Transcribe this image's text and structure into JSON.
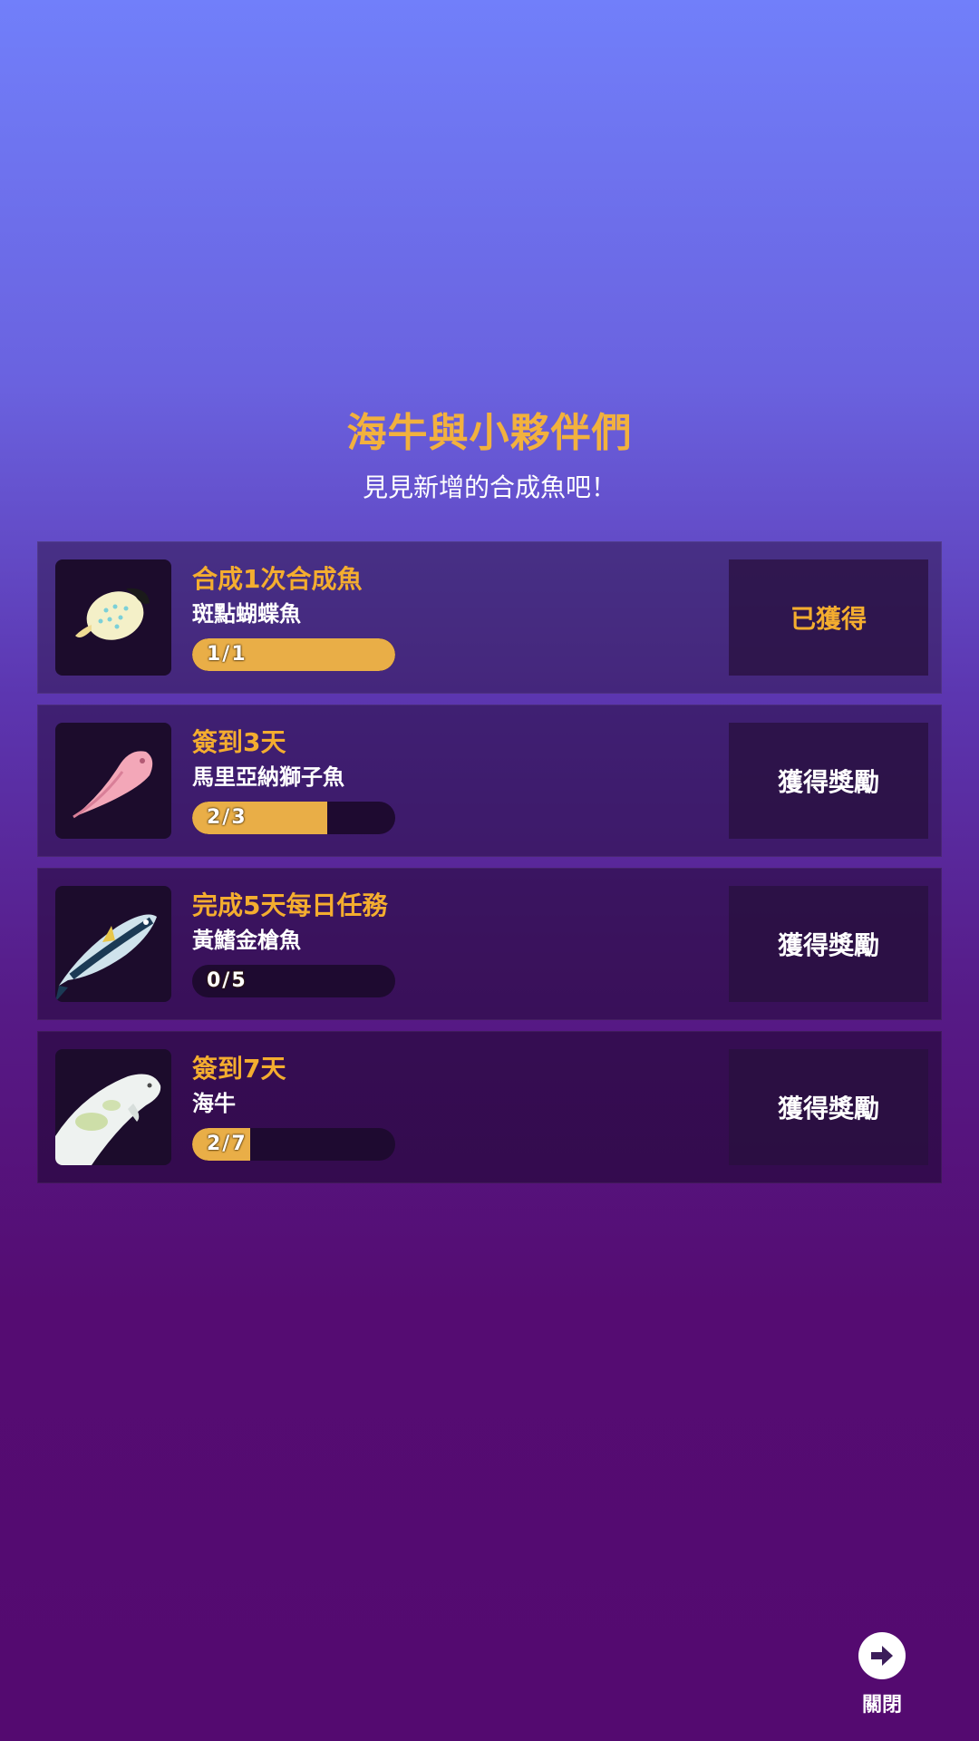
{
  "header": {
    "title": "海牛與小夥伴們",
    "subtitle": "見見新增的合成魚吧！"
  },
  "tasks": [
    {
      "task": "合成1次合成魚",
      "fish": "斑點蝴蝶魚",
      "progress_label": "1/1",
      "progress_fraction": 1.0,
      "action_label": "已獲得",
      "claimed": true,
      "icon": "spotted-butterflyfish-icon"
    },
    {
      "task": "簽到3天",
      "fish": "馬里亞納獅子魚",
      "progress_label": "2/3",
      "progress_fraction": 0.667,
      "action_label": "獲得獎勵",
      "claimed": false,
      "icon": "mariana-snailfish-icon"
    },
    {
      "task": "完成5天每日任務",
      "fish": "黃鰭金槍魚",
      "progress_label": "0/5",
      "progress_fraction": 0.0,
      "action_label": "獲得獎勵",
      "claimed": false,
      "icon": "yellowfin-tuna-icon"
    },
    {
      "task": "簽到7天",
      "fish": "海牛",
      "progress_label": "2/7",
      "progress_fraction": 0.286,
      "action_label": "獲得獎勵",
      "claimed": false,
      "icon": "manatee-icon"
    }
  ],
  "close": {
    "label": "關閉",
    "icon": "arrow-right-icon"
  },
  "colors": {
    "accent": "#f4ad2f",
    "bar_fill": "#e9ae47"
  }
}
